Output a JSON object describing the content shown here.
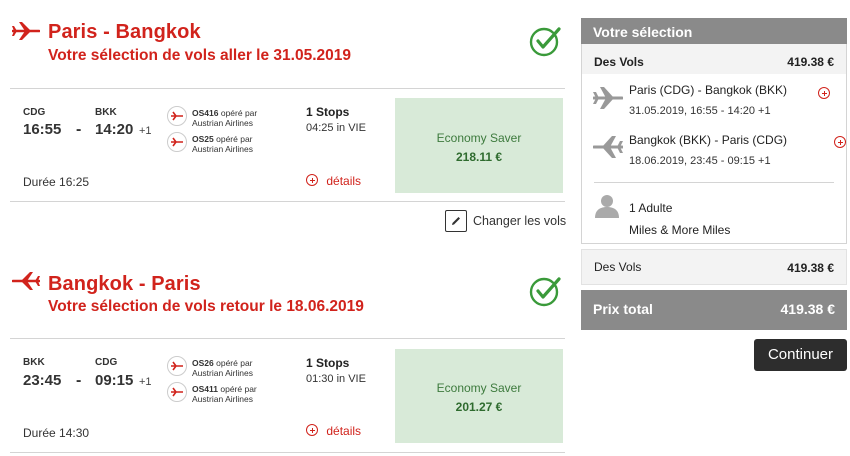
{
  "outbound": {
    "title": "Paris - Bangkok",
    "subtitle": "Votre sélection de vols aller le 31.05.2019",
    "dep_code": "CDG",
    "arr_code": "BKK",
    "dep_time": "16:55",
    "dash": "-",
    "arr_time": "14:20",
    "day_offset": "+1",
    "flights": [
      {
        "number": "OS416",
        "operated": "opéré par",
        "airline": "Austrian Airlines"
      },
      {
        "number": "OS25",
        "operated": "opéré par",
        "airline": "Austrian Airlines"
      }
    ],
    "stops": "1 Stops",
    "via": "04:25 in VIE",
    "duration": "Durée 16:25",
    "details": "détails",
    "fare_name": "Economy Saver",
    "fare_price": "218.11 €"
  },
  "change_flights_label": "Changer les vols",
  "inbound": {
    "title": "Bangkok - Paris",
    "subtitle": "Votre sélection de vols retour le 18.06.2019",
    "dep_code": "BKK",
    "arr_code": "CDG",
    "dep_time": "23:45",
    "dash": "-",
    "arr_time": "09:15",
    "day_offset": "+1",
    "flights": [
      {
        "number": "OS26",
        "operated": "opéré par",
        "airline": "Austrian Airlines"
      },
      {
        "number": "OS411",
        "operated": "opéré par",
        "airline": "Austrian Airlines"
      }
    ],
    "stops": "1 Stops",
    "via": "01:30 in VIE",
    "duration": "Durée 14:30",
    "details": "détails",
    "fare_name": "Economy Saver",
    "fare_price": "201.27 €"
  },
  "summary": {
    "title": "Votre sélection",
    "flights_label": "Des Vols",
    "flights_price": "419.38 €",
    "out_route": "Paris (CDG) - Bangkok (BKK)",
    "out_date": "31.05.2019, 16:55 - 14:20 +1",
    "ret_route": "Bangkok (BKK) - Paris (CDG)",
    "ret_date": "18.06.2019, 23:45 - 09:15 +1",
    "passengers": "1 Adulte",
    "miles": "Miles & More Miles",
    "subtotal_label": "Des Vols",
    "subtotal_price": "419.38 €",
    "total_label": "Prix total",
    "total_price": "419.38 €"
  },
  "continue_label": "Continuer",
  "colors": {
    "brand_red": "#d1231c",
    "check_green": "#3a9a3a",
    "fare_bg": "#d8ead8",
    "panel_grey": "#8a8a8a"
  }
}
